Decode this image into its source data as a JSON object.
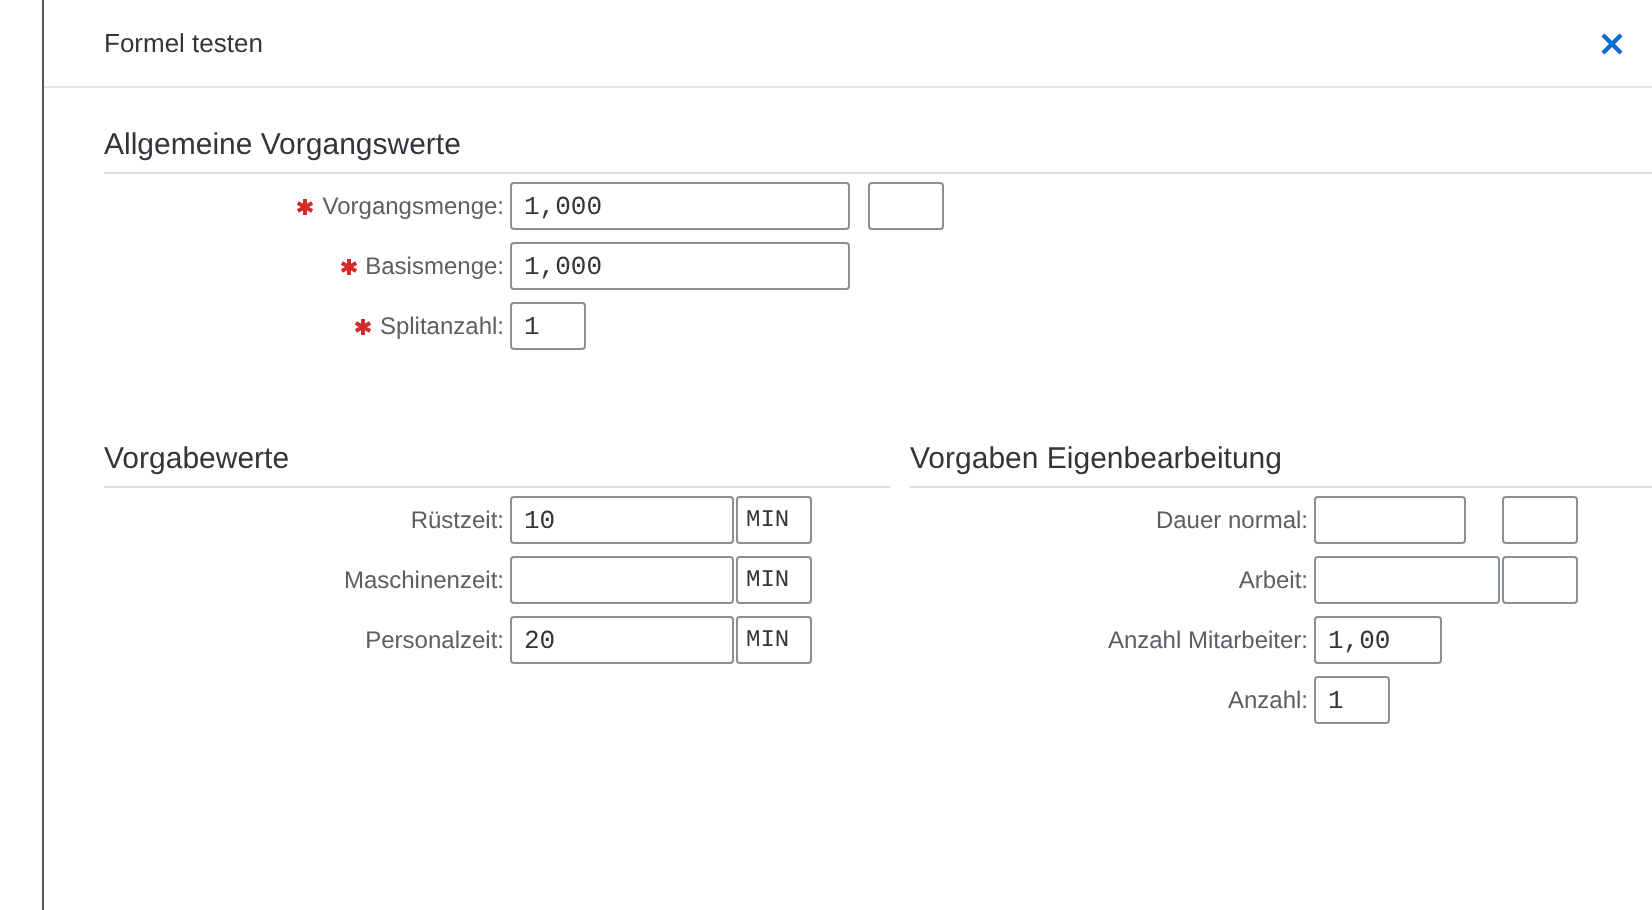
{
  "dialog": {
    "title": "Formel testen"
  },
  "sections": [
    {
      "title": "Allgemeine Vorgangswerte",
      "fields": [
        {
          "label": "Vorgangsmenge:",
          "required": true,
          "value": "1,000",
          "kind": "long",
          "unit_field": true
        },
        {
          "label": "Basismenge:",
          "required": true,
          "value": "1,000",
          "kind": "long",
          "unit_field": false
        },
        {
          "label": "Splitanzahl:",
          "required": true,
          "value": "1",
          "kind": "short",
          "unit_field": false
        }
      ]
    },
    {
      "title": "Vorgabewerte",
      "fields": [
        {
          "label": "Rüstzeit:",
          "required": false,
          "value": "10",
          "kind": "medium",
          "unit_field": true,
          "unit": "MIN"
        },
        {
          "label": "Maschinenzeit:",
          "required": false,
          "kind": "medium",
          "unit_field": true,
          "unit": "MIN"
        },
        {
          "label": "Personalzeit:",
          "required": false,
          "value": "20",
          "kind": "medium",
          "unit_field": true,
          "unit": "MIN"
        }
      ]
    },
    {
      "title": "Vorgaben Eigenbearbeitung",
      "fields": [
        {
          "label": "Dauer normal:",
          "required": false,
          "kind": "duration",
          "unit_field": true
        },
        {
          "label": "Arbeit:",
          "required": false,
          "kind": "work",
          "unit_field": true
        },
        {
          "label": "Anzahl Mitarbeiter:",
          "required": false,
          "value": "1,00",
          "kind": "decimal",
          "unit_field": false
        },
        {
          "label": "Anzahl:",
          "required": false,
          "value": "1",
          "kind": "short",
          "unit_field": false
        }
      ]
    }
  ]
}
